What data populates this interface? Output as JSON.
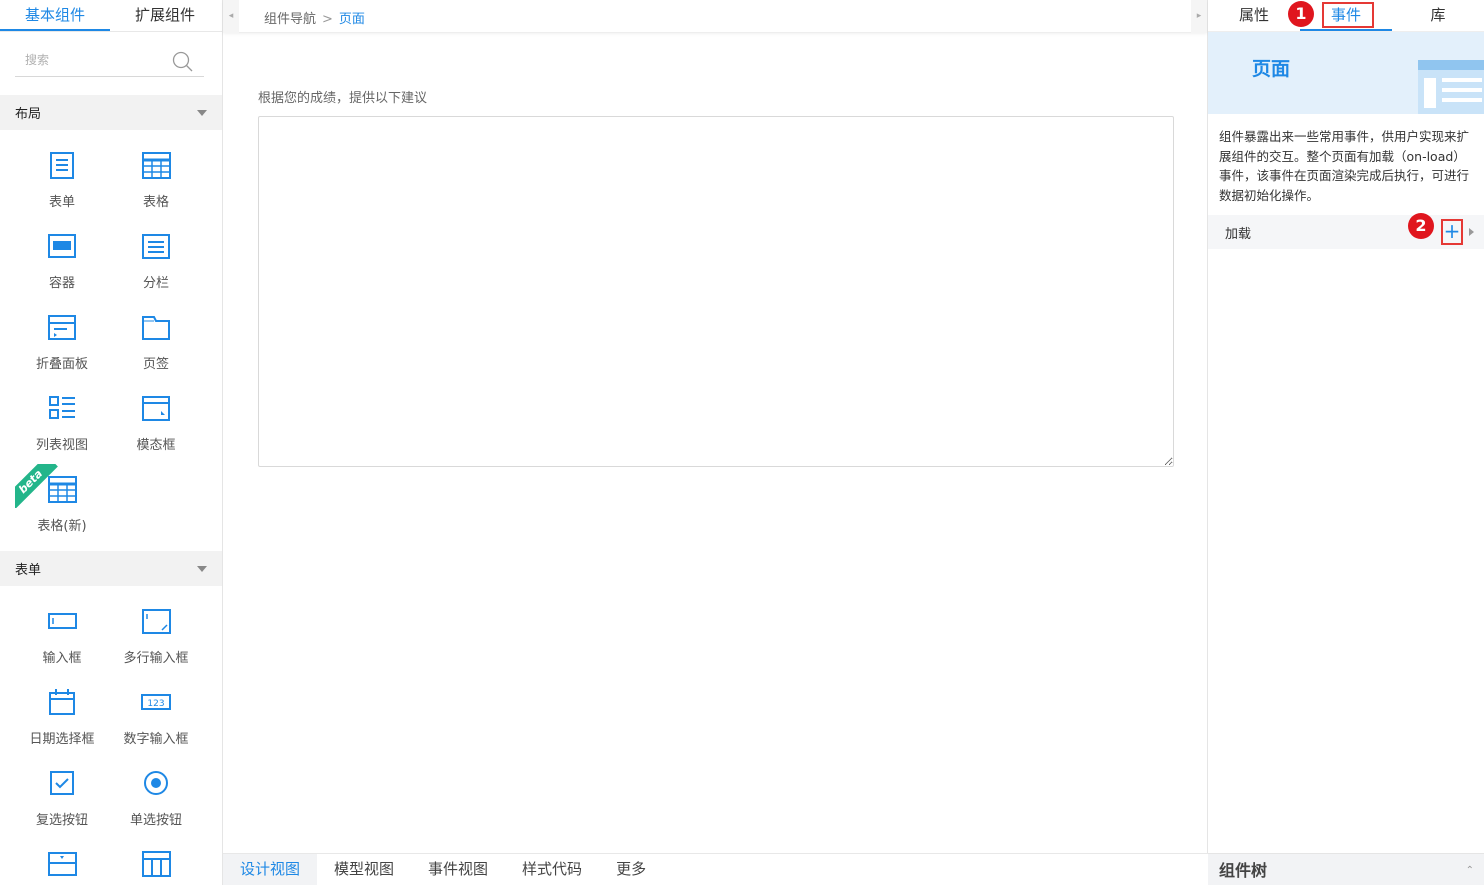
{
  "left_panel": {
    "tabs": [
      "基本组件",
      "扩展组件"
    ],
    "search_placeholder": "搜索",
    "sections": [
      {
        "title": "布局",
        "items": [
          {
            "label": "表单",
            "icon": "form-icon"
          },
          {
            "label": "表格",
            "icon": "table-icon"
          },
          {
            "label": "容器",
            "icon": "container-icon"
          },
          {
            "label": "分栏",
            "icon": "columns-icon"
          },
          {
            "label": "折叠面板",
            "icon": "collapse-panel-icon"
          },
          {
            "label": "页签",
            "icon": "tabs-icon"
          },
          {
            "label": "列表视图",
            "icon": "list-view-icon"
          },
          {
            "label": "模态框",
            "icon": "modal-icon"
          },
          {
            "label": "表格(新)",
            "icon": "table-new-icon",
            "badge": "beta"
          }
        ]
      },
      {
        "title": "表单",
        "items": [
          {
            "label": "输入框",
            "icon": "input-icon"
          },
          {
            "label": "多行输入框",
            "icon": "textarea-icon"
          },
          {
            "label": "日期选择框",
            "icon": "date-picker-icon"
          },
          {
            "label": "数字输入框",
            "icon": "number-input-icon"
          },
          {
            "label": "复选按钮",
            "icon": "checkbox-icon"
          },
          {
            "label": "单选按钮",
            "icon": "radio-icon"
          },
          {
            "label": "",
            "icon": "select-icon"
          },
          {
            "label": "",
            "icon": "grid-icon"
          }
        ]
      }
    ]
  },
  "center": {
    "breadcrumb": [
      "组件导航",
      "页面"
    ],
    "field_label": "根据您的成绩，提供以下建议",
    "bottom_tabs": [
      "设计视图",
      "模型视图",
      "事件视图",
      "样式代码",
      "更多"
    ]
  },
  "right_panel": {
    "tabs": [
      "属性",
      "事件",
      "库"
    ],
    "banner_title": "页面",
    "description": "组件暴露出来一些常用事件，供用户实现来扩展组件的交互。整个页面有加载（on-load）事件，该事件在页面渲染完成后执行，可进行数据初始化操作。",
    "event_row": {
      "label": "加载",
      "add": "+"
    },
    "annotations": [
      "1",
      "2"
    ],
    "tree_title": "组件树"
  },
  "colors": {
    "accent": "#1e88e5",
    "annotation_red": "#e0161e",
    "beta_green": "#23b58a"
  }
}
